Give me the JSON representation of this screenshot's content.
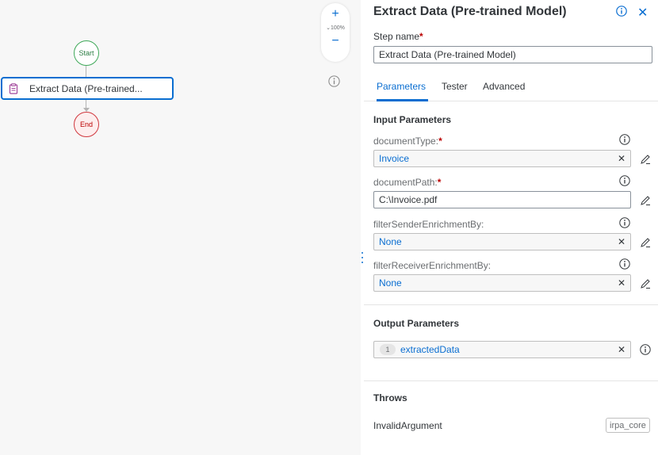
{
  "canvas": {
    "start_label": "Start",
    "end_label": "End",
    "step_label": "Extract Data (Pre-trained...",
    "zoom_plus": "+",
    "zoom_minus": "−",
    "zoom_level": "⌄100%"
  },
  "panel": {
    "title": "Extract Data (Pre-trained Model)",
    "close": "✕",
    "step_name_label": "Step name",
    "step_name_value": "Extract Data (Pre-trained Model)",
    "required_mark": "*",
    "tabs": [
      {
        "label": "Parameters"
      },
      {
        "label": "Tester"
      },
      {
        "label": "Advanced"
      }
    ],
    "input_section_title": "Input Parameters",
    "params": [
      {
        "label": "documentType:",
        "required": "*",
        "value": "Invoice",
        "clear": "✕"
      },
      {
        "label": "documentPath:",
        "required": "*",
        "value": "C:\\Invoice.pdf"
      },
      {
        "label": "filterSenderEnrichmentBy:",
        "value": "None",
        "clear": "✕"
      },
      {
        "label": "filterReceiverEnrichmentBy:",
        "value": "None",
        "clear": "✕"
      }
    ],
    "output_section_title": "Output Parameters",
    "output": {
      "index": "1",
      "name": "extractedData",
      "clear": "✕"
    },
    "throws_section_title": "Throws",
    "throws": {
      "name": "InvalidArgument",
      "tag": "irpa_core"
    }
  },
  "colors": {
    "accent": "#0a6ed1",
    "start_green": "#3ea858",
    "end_red": "#d0373d",
    "required": "#bb0000"
  }
}
